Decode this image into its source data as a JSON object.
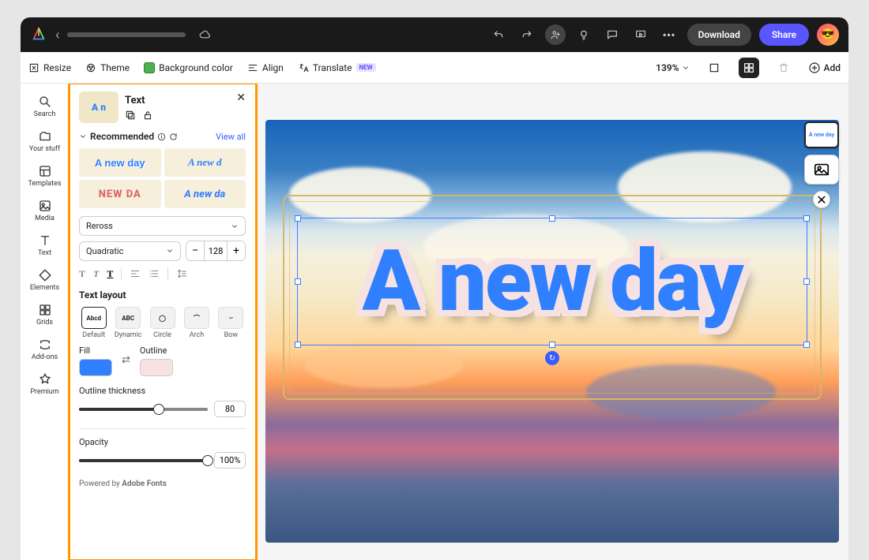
{
  "topbar": {
    "download": "Download",
    "share": "Share"
  },
  "toolbar": {
    "resize": "Resize",
    "theme": "Theme",
    "bgcolor": "Background color",
    "align": "Align",
    "translate": "Translate",
    "translate_badge": "NEW",
    "zoom": "139%",
    "add": "Add"
  },
  "nav": {
    "search": "Search",
    "yourstuff": "Your stuff",
    "templates": "Templates",
    "media": "Media",
    "text": "Text",
    "elements": "Elements",
    "grids": "Grids",
    "addons": "Add-ons",
    "premium": "Premium"
  },
  "panel": {
    "title": "Text",
    "recommended": "Recommended",
    "viewall": "View all",
    "rec1": "A new day",
    "rec2": "A new d",
    "rec3": "NEW DA",
    "rec4": "A new da",
    "font_family": "Reross",
    "font_style": "Quadratic",
    "font_size": "128",
    "textlayout": "Text layout",
    "layouts": {
      "default": "Default",
      "default_sym": "Abcd",
      "dynamic": "Dynamic",
      "dynamic_sym": "ABC",
      "circle": "Circle",
      "arch": "Arch",
      "bow": "Bow"
    },
    "fill": "Fill",
    "outline": "Outline",
    "outline_thickness": "Outline thickness",
    "outline_val": "80",
    "opacity": "Opacity",
    "opacity_val": "100%",
    "footer_prefix": "Powered by ",
    "footer_brand": "Adobe Fonts"
  },
  "canvas": {
    "text": "A new day",
    "mini_thumb": "A new day"
  },
  "colors": {
    "fill": "#2f7fff",
    "outline": "#f6e2e2"
  }
}
